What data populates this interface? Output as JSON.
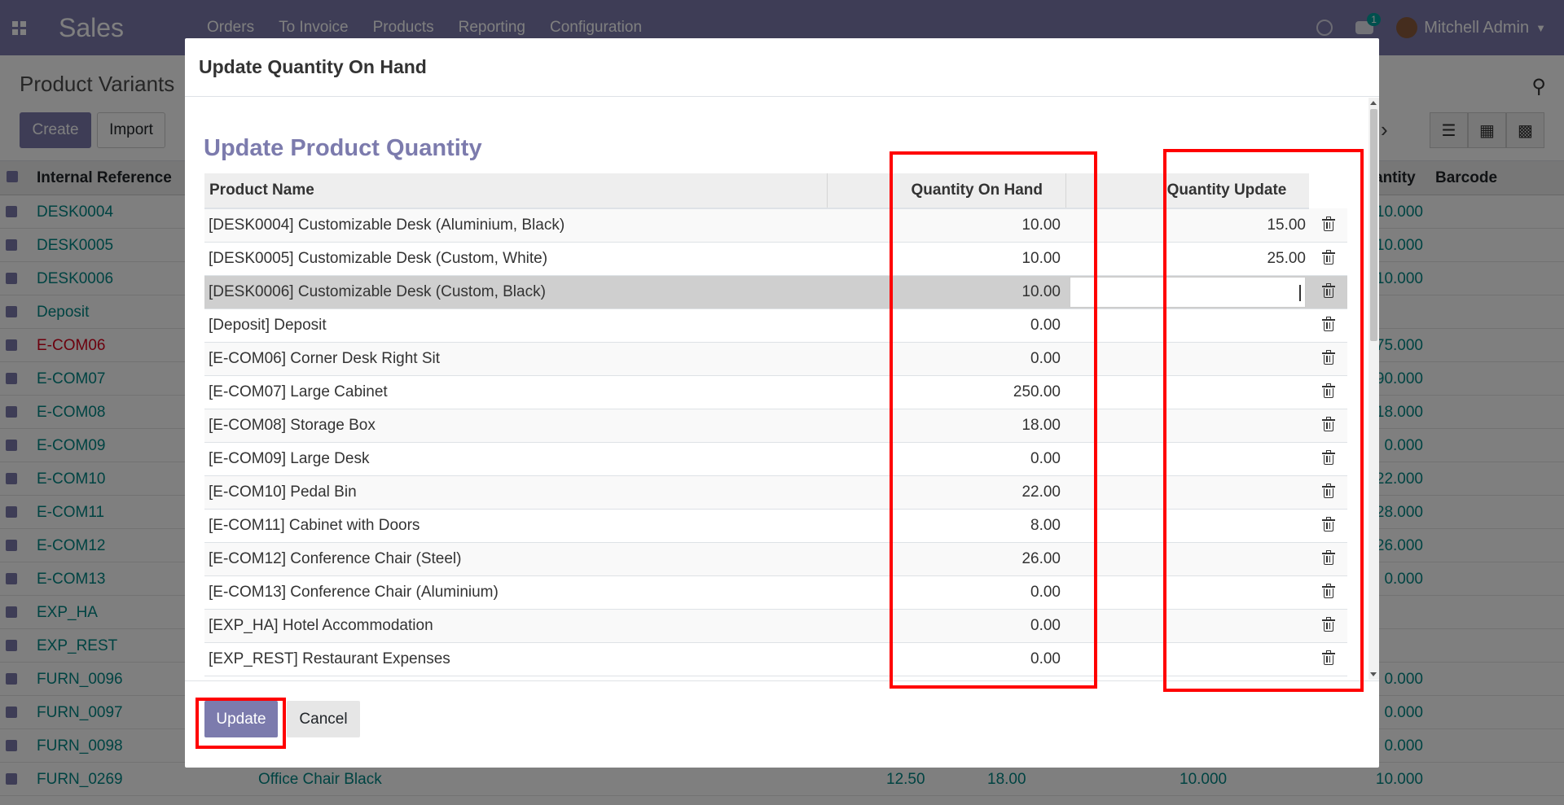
{
  "app": {
    "brand": "Sales",
    "menu": [
      "Orders",
      "To Invoice",
      "Products",
      "Reporting",
      "Configuration"
    ],
    "user": "Mitchell Admin",
    "chat_count": "1"
  },
  "page": {
    "breadcrumb": "Product Variants",
    "create_label": "Create",
    "import_label": "Import",
    "columns": {
      "ref": "Internal Reference",
      "qty": "antity",
      "barcode": "Barcode"
    }
  },
  "background_rows": [
    {
      "ref": "DESK0004",
      "qty": "10.000"
    },
    {
      "ref": "DESK0005",
      "qty": "10.000"
    },
    {
      "ref": "DESK0006",
      "qty": "10.000"
    },
    {
      "ref": "Deposit",
      "qty": ""
    },
    {
      "ref": "E-COM06",
      "qty": "75.000",
      "red": true
    },
    {
      "ref": "E-COM07",
      "qty": "90.000"
    },
    {
      "ref": "E-COM08",
      "qty": "18.000"
    },
    {
      "ref": "E-COM09",
      "qty": "0.000"
    },
    {
      "ref": "E-COM10",
      "qty": "22.000"
    },
    {
      "ref": "E-COM11",
      "qty": "28.000"
    },
    {
      "ref": "E-COM12",
      "qty": "26.000"
    },
    {
      "ref": "E-COM13",
      "qty": "0.000"
    },
    {
      "ref": "EXP_HA",
      "qty": ""
    },
    {
      "ref": "EXP_REST",
      "qty": ""
    },
    {
      "ref": "FURN_0096",
      "qty": "0.000"
    },
    {
      "ref": "FURN_0097",
      "qty": "0.000"
    },
    {
      "ref": "FURN_0098",
      "qty": "0.000"
    },
    {
      "ref": "FURN_0269",
      "qty": "10.000",
      "name": "Office Chair Black",
      "price": "12.50",
      "cost": "18.00",
      "forecast": "10.000"
    }
  ],
  "modal": {
    "title": "Update Quantity On Hand",
    "form_title": "Update Product Quantity",
    "headers": {
      "name": "Product Name",
      "qoh": "Quantity On Hand",
      "update": "Quantity Update"
    },
    "rows": [
      {
        "name": "[DESK0004] Customizable Desk (Aluminium, Black)",
        "qoh": "10.00",
        "update": "15.00"
      },
      {
        "name": "[DESK0005] Customizable Desk (Custom, White)",
        "qoh": "10.00",
        "update": "25.00"
      },
      {
        "name": "[DESK0006] Customizable Desk (Custom, Black)",
        "qoh": "10.00",
        "update": "",
        "editing": true
      },
      {
        "name": "[Deposit] Deposit",
        "qoh": "0.00",
        "update": ""
      },
      {
        "name": "[E-COM06] Corner Desk Right Sit",
        "qoh": "0.00",
        "update": ""
      },
      {
        "name": "[E-COM07] Large Cabinet",
        "qoh": "250.00",
        "update": ""
      },
      {
        "name": "[E-COM08] Storage Box",
        "qoh": "18.00",
        "update": ""
      },
      {
        "name": "[E-COM09] Large Desk",
        "qoh": "0.00",
        "update": ""
      },
      {
        "name": "[E-COM10] Pedal Bin",
        "qoh": "22.00",
        "update": ""
      },
      {
        "name": "[E-COM11] Cabinet with Doors",
        "qoh": "8.00",
        "update": ""
      },
      {
        "name": "[E-COM12] Conference Chair (Steel)",
        "qoh": "26.00",
        "update": ""
      },
      {
        "name": "[E-COM13] Conference Chair (Aluminium)",
        "qoh": "0.00",
        "update": ""
      },
      {
        "name": "[EXP_HA] Hotel Accommodation",
        "qoh": "0.00",
        "update": ""
      },
      {
        "name": "[EXP_REST] Restaurant Expenses",
        "qoh": "0.00",
        "update": ""
      }
    ],
    "update_label": "Update",
    "cancel_label": "Cancel"
  },
  "colors": {
    "brand": "#7c7bad",
    "link": "#008784",
    "danger": "#d9001b",
    "highlight": "#ff0000"
  },
  "icons": [
    "apps-icon",
    "clock-icon",
    "chat-icon",
    "search-icon",
    "chevron-right-icon",
    "list-view-icon",
    "kanban-view-icon",
    "grid-view-icon",
    "trash-icon"
  ]
}
